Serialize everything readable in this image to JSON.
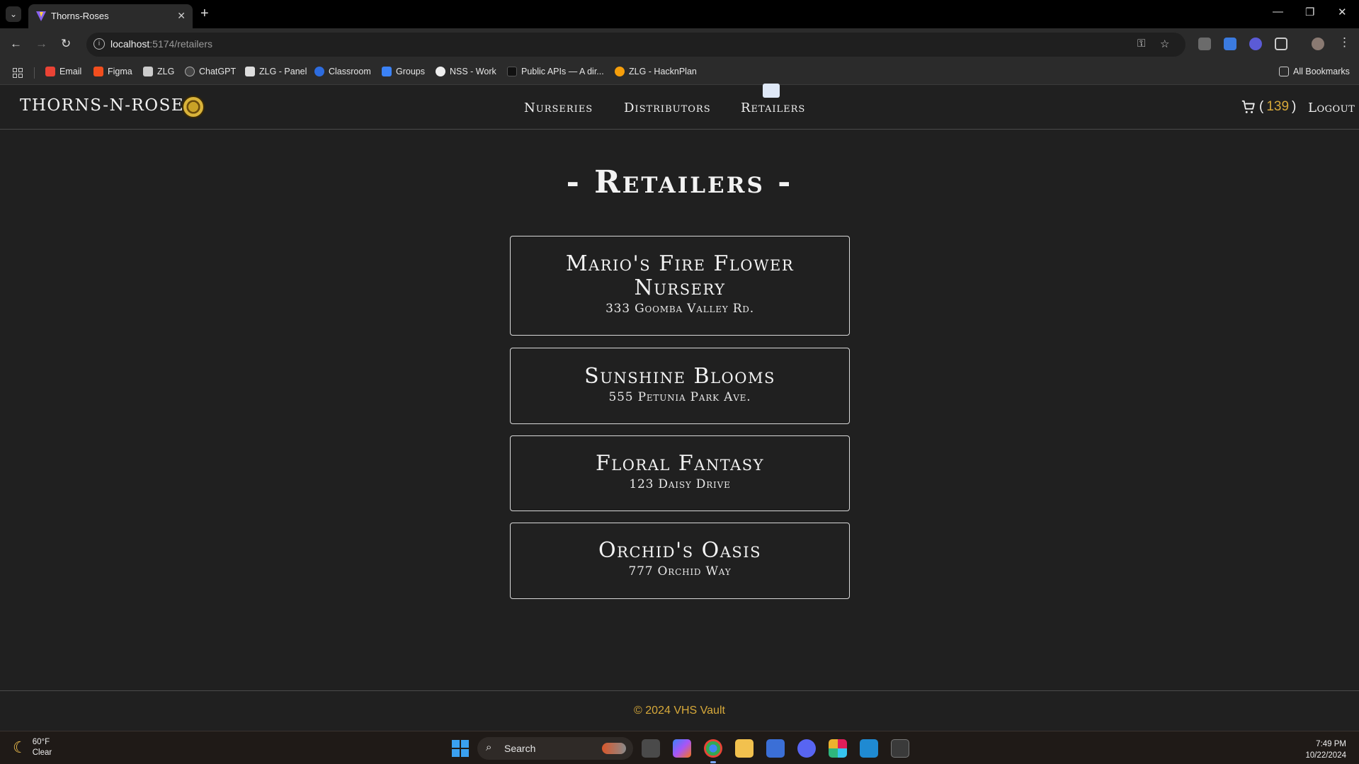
{
  "browser": {
    "tab_title": "Thorns-Roses",
    "url_host": "localhost",
    "url_path": ":5174/retailers",
    "bookmarks": [
      "Email",
      "Figma",
      "ZLG",
      "ChatGPT",
      "ZLG - Panel",
      "Classroom",
      "Groups",
      "NSS - Work",
      "Public APIs — A dir...",
      "ZLG - HacknPlan"
    ],
    "all_bookmarks": "All Bookmarks"
  },
  "nav": {
    "brand": "THORNS-N-ROSES",
    "links": [
      "Nurseries",
      "Distributors",
      "Retailers"
    ],
    "cart_open": "(",
    "cart_count": "139",
    "cart_close": ")",
    "logout": "Logout"
  },
  "main": {
    "heading": "- Retailers -",
    "retailers": [
      {
        "name": "Mario's Fire Flower Nursery",
        "address": "333 Goomba Valley Rd."
      },
      {
        "name": "Sunshine Blooms",
        "address": "555 Petunia Park Ave."
      },
      {
        "name": "Floral Fantasy",
        "address": "123 Daisy Drive"
      },
      {
        "name": "Orchid's Oasis",
        "address": "777 Orchid Way"
      }
    ]
  },
  "footer": {
    "copyright": "© 2024 VHS Vault"
  },
  "taskbar": {
    "temp": "60°F",
    "condition": "Clear",
    "search_label": "Search",
    "time": "7:49 PM",
    "date": "10/22/2024"
  },
  "colors": {
    "accent": "#d7a93a",
    "background": "#202020",
    "border": "#d8d8d8"
  }
}
